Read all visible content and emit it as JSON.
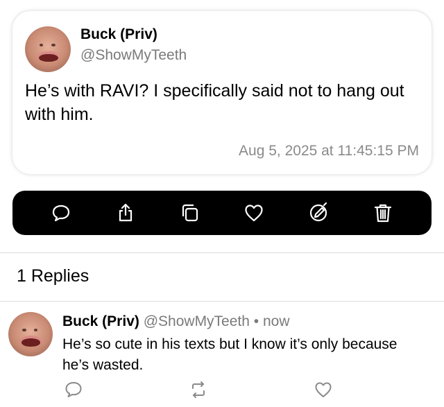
{
  "post": {
    "display_name": "Buck (Priv)",
    "handle": "@ShowMyTeeth",
    "text": "He’s with RAVI? I specifically said not to hang out with him.",
    "timestamp": "Aug 5, 2025 at 11:45:15 PM"
  },
  "actions": [
    {
      "icon": "reply-icon"
    },
    {
      "icon": "share-icon"
    },
    {
      "icon": "copy-icon"
    },
    {
      "icon": "heart-icon"
    },
    {
      "icon": "edit-icon"
    },
    {
      "icon": "trash-icon"
    }
  ],
  "replies": {
    "count_label": "1 Replies",
    "items": [
      {
        "display_name": "Buck (Priv)",
        "handle": "@ShowMyTeeth",
        "separator": "•",
        "time": "now",
        "text": "He’s so cute in his texts but I know it’s only because he’s wasted.",
        "actions": [
          {
            "icon": "reply-icon"
          },
          {
            "icon": "repost-icon"
          },
          {
            "icon": "heart-icon"
          }
        ]
      }
    ]
  },
  "colors": {
    "action_bar_bg": "#000000",
    "secondary_text": "#7a7a7a",
    "reply_icon_color": "#8a8a8a"
  }
}
